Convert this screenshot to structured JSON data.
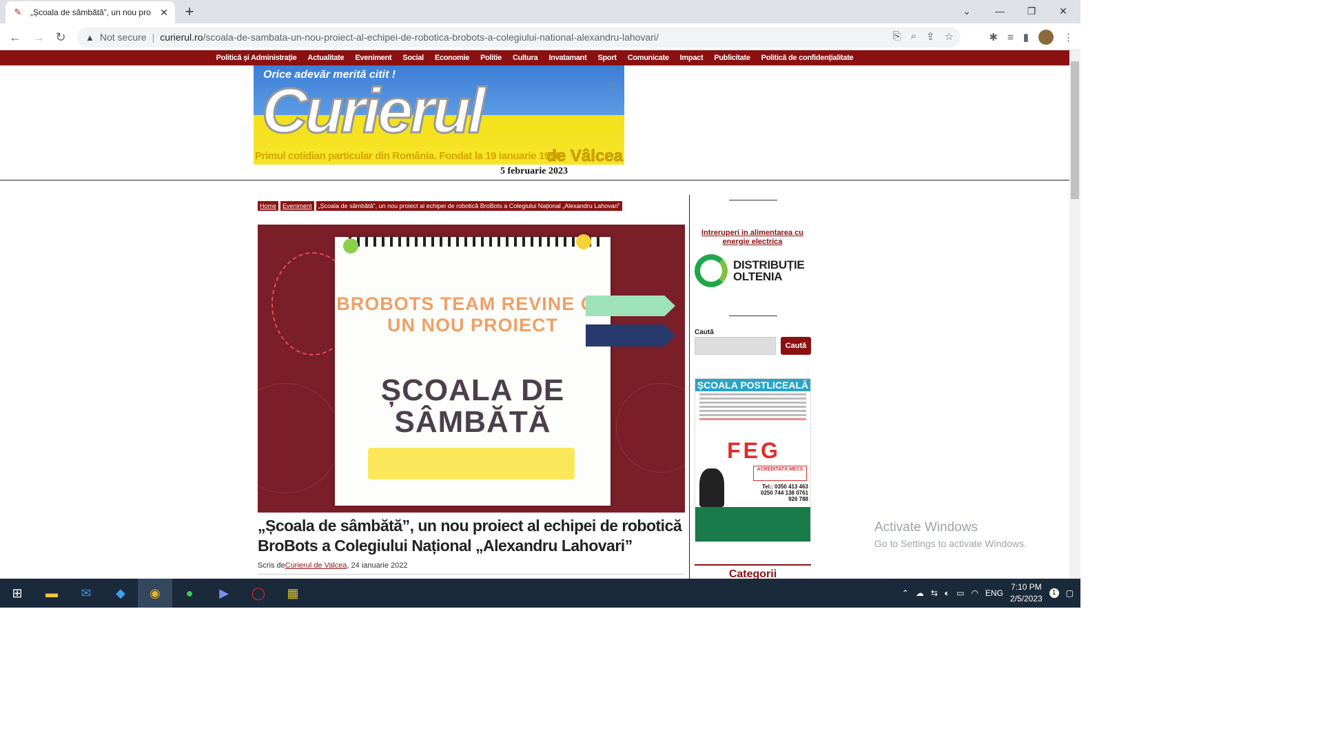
{
  "browser": {
    "tab_title": "„Școala de sâmbătă”, un nou pro",
    "new_tab": "+",
    "security": "Not secure",
    "url_host": "curierul.ro",
    "url_path": "/scoala-de-sambata-un-nou-proiect-al-echipei-de-robotica-brobots-a-colegiului-national-alexandru-lahovari/"
  },
  "nav": {
    "items": [
      "Politică și Administrație",
      "Actualitate",
      "Eveniment",
      "Social",
      "Economie",
      "Politie",
      "Cultura",
      "Invatamant",
      "Sport",
      "Comunicate",
      "Impact",
      "Publicitate",
      "Politică de confidențialitate"
    ]
  },
  "logo": {
    "tagline": "Orice adevăr merită citit !",
    "name": "Curierul",
    "subtitle": "Primul cotidian particular din România. Fondat la 19 ianuarie 1990",
    "region": "de Vâlcea",
    "registered": "®"
  },
  "date": "5 februarie 2023",
  "breadcrumb": [
    "Home",
    "Eveniment",
    "„Școala de sâmbătă”, un nou proiect al echipei de robotică BroBots a Colegiului Național „Alexandru Lahovari”"
  ],
  "hero": {
    "line1": "BROBOTS TEAM REVINE CU UN NOU PROIECT",
    "line2": "ȘCOALA DE SÂMBĂTĂ"
  },
  "article": {
    "title": "„Școala de sâmbătă”, un nou proiect al echipei de robotică BroBots a Colegiului Național „Alexandru Lahovari”",
    "by_prefix": "Scris de",
    "author": "Curierul de Valcea",
    "date": ", 24 ianuarie 2022"
  },
  "sidebar": {
    "outage_link": "Intreruperi in alimentarea cu energie electrica",
    "dist_name": "DISTRIBUȚIE OLTENIA",
    "search_label": "Caută",
    "search_button": "Caută",
    "ad_head": "ȘCOALA POSTLICEALĂ",
    "ad_brand": "FEG",
    "ad_acr": "ACREDITATĂ MECS",
    "ad_tel": "Tel.: 0350 413 463 0250 744 138 0761 926 788",
    "categories": "Categorii"
  },
  "watermark": {
    "line1": "Activate Windows",
    "line2": "Go to Settings to activate Windows."
  },
  "taskbar": {
    "lang": "ENG",
    "time": "7:10 PM",
    "date": "2/5/2023",
    "badge": "1"
  },
  "colors": {
    "brand_red": "#8b1111",
    "hero_bg": "#7a1e28",
    "taskbar": "#1b2a3a"
  }
}
